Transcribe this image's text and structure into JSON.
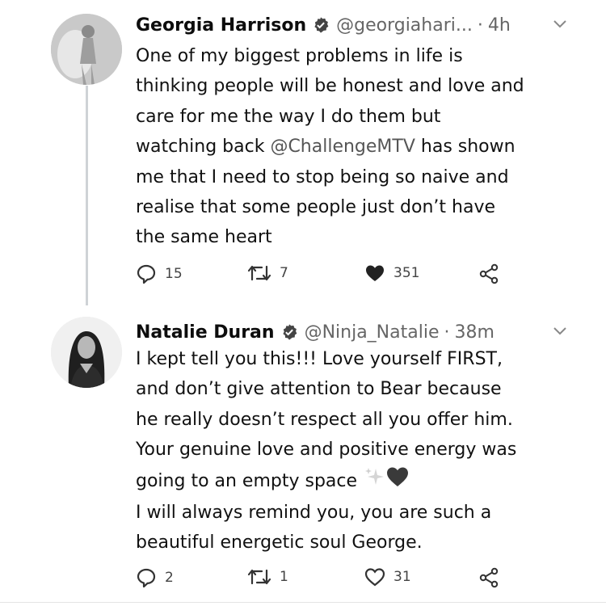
{
  "tweets": [
    {
      "name": "Georgia Harrison",
      "handle": "@georgiahari...",
      "separator": "·",
      "time": "4h",
      "text_before_mention": "One of my biggest problems in life is\nthinking people will be honest and love and\ncare for me the way I do them but\nwatching back ",
      "mention": "@ChallengeMTV",
      "text_after_mention": " has shown\nme that I need to stop being so naive and\nrealise that some people just don’t have\nthe same heart",
      "replies": "15",
      "retweets": "7",
      "likes": "351",
      "liked": true
    },
    {
      "name": "Natalie Duran",
      "handle": "@Ninja_Natalie",
      "separator": "·",
      "time": "38m",
      "text_line1": "I kept tell you this!!! Love yourself FIRST,\nand don’t give attention to Bear because\nhe really doesn’t respect all you offer him.\nYour genuine love and positive energy was\ngoing to an empty space ",
      "text_line2": "\nI will always remind you, you are such a\nbeautiful energetic soul George.",
      "emojis": [
        "sparkles-emoji",
        "black-heart-emoji"
      ],
      "replies": "2",
      "retweets": "1",
      "likes": "31",
      "liked": false
    }
  ],
  "icons": {
    "verified": "verified-badge-icon",
    "more": "chevron-down-icon",
    "reply": "reply-icon",
    "retweet": "retweet-icon",
    "like": "heart-icon",
    "share": "share-icon"
  },
  "colors": {
    "text": "#111111",
    "secondary": "#666666",
    "thread_line": "#cfd3d6"
  }
}
